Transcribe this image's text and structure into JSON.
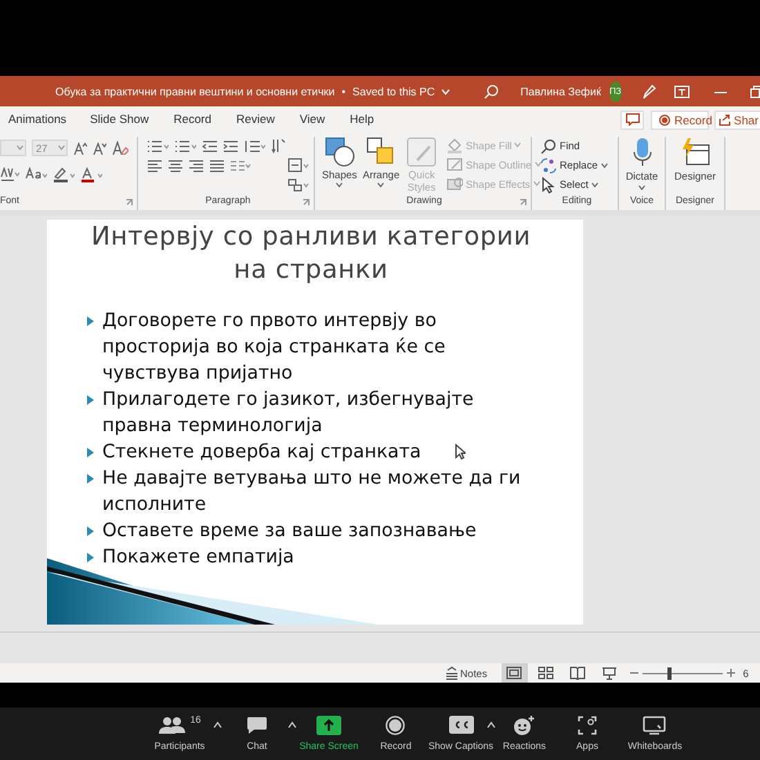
{
  "window": {
    "title": "Обука за практични правни вештини и основни етички",
    "separator": "•",
    "save_status": "Saved to this PC",
    "user": "Павлина Зефиќ",
    "user_initials": "ПЗ"
  },
  "ribbon_tabs": [
    {
      "label": "Animations",
      "selected": false
    },
    {
      "label": "Slide Show",
      "selected": false
    },
    {
      "label": "Record",
      "selected": false
    },
    {
      "label": "Review",
      "selected": false
    },
    {
      "label": "View",
      "selected": false
    },
    {
      "label": "Help",
      "selected": false
    }
  ],
  "ribbon_actions": {
    "record": "Record",
    "share": "Shar"
  },
  "ribbon": {
    "font": {
      "size": "27",
      "label": "Font"
    },
    "paragraph": {
      "label": "Paragraph"
    },
    "drawing": {
      "shapes": "Shapes",
      "arrange": "Arrange",
      "quick_styles": {
        "label": "Quick Styles",
        "disabled": true
      },
      "format": [
        {
          "kind": "fill",
          "label": "Shape Fill",
          "disabled": true
        },
        {
          "kind": "outline",
          "label": "Shape Outline",
          "disabled": true
        },
        {
          "kind": "effects",
          "label": "Shape Effects",
          "disabled": true
        }
      ],
      "label": "Drawing"
    },
    "editing": {
      "items": [
        {
          "kind": "find",
          "label": "Find"
        },
        {
          "kind": "replace",
          "label": "Replace"
        },
        {
          "kind": "select",
          "label": "Select"
        }
      ],
      "label": "Editing"
    },
    "voice": {
      "button": "Dictate",
      "label": "Voice"
    },
    "designer": {
      "button": "Designer",
      "label": "Designer"
    }
  },
  "slide": {
    "title": "Интервју со ранливи категории на странки",
    "bullets": [
      "Договорете го првото интервју во просторија во која странката ќе се чувствува пријатно",
      "Прилагодете го јазикот, избегнувајте правна терминологија",
      "Стекнете доверба кај странката",
      "Не давајте ветувања што не можете да ги исполните",
      "Оставете време за ваше запознавање",
      "Покажете емпатија"
    ]
  },
  "status_bar": {
    "notes": "Notes",
    "views": [
      {
        "kind": "normal",
        "selected": true
      },
      {
        "kind": "sorter",
        "selected": false
      },
      {
        "kind": "reading",
        "selected": false
      },
      {
        "kind": "presenter",
        "selected": false
      }
    ],
    "zoom_slider": {
      "level": 0.33
    },
    "zoom_percent": "6"
  },
  "meeting_toolbar": [
    {
      "kind": "participants",
      "label": "Participants",
      "count": "16",
      "menu": true
    },
    {
      "kind": "chat",
      "label": "Chat",
      "menu": true
    },
    {
      "kind": "share",
      "label": "Share Screen",
      "menu": false
    },
    {
      "kind": "record",
      "label": "Record",
      "menu": false
    },
    {
      "kind": "captions",
      "label": "Show Captions",
      "menu": true
    },
    {
      "kind": "reactions",
      "label": "Reactions",
      "menu": false
    },
    {
      "kind": "apps",
      "label": "Apps",
      "menu": false
    },
    {
      "kind": "whiteboards",
      "label": "Whiteboards",
      "menu": false
    }
  ]
}
